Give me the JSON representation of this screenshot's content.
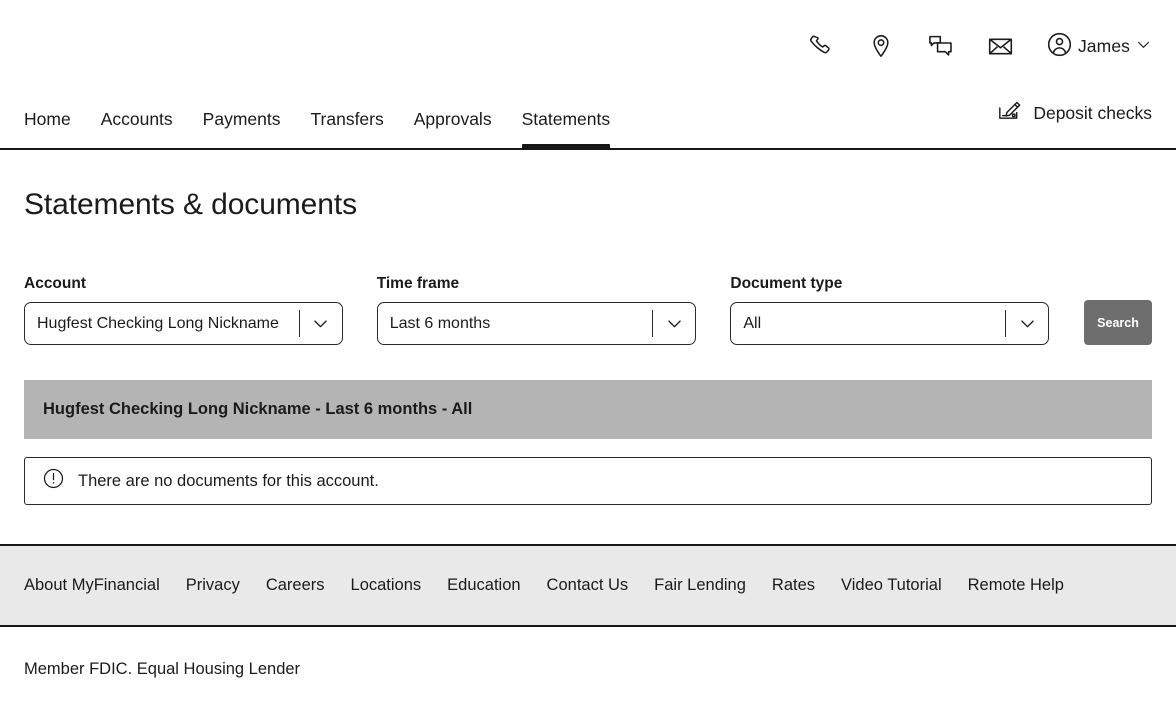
{
  "utility": {
    "icons": [
      {
        "name": "phone-icon",
        "label": "Call us"
      },
      {
        "name": "location-pin-icon",
        "label": "Find a location"
      },
      {
        "name": "chat-bubbles-icon",
        "label": "Chat"
      },
      {
        "name": "envelope-icon",
        "label": "Messages"
      }
    ],
    "profile": {
      "icon": "user-circle-icon",
      "name": "James",
      "chevron": "chevron-down-icon"
    }
  },
  "nav": {
    "items": [
      {
        "label": "Home",
        "active": false
      },
      {
        "label": "Accounts",
        "active": false
      },
      {
        "label": "Payments",
        "active": false
      },
      {
        "label": "Transfers",
        "active": false
      },
      {
        "label": "Approvals",
        "active": false
      },
      {
        "label": "Statements",
        "active": true
      }
    ],
    "deposit": {
      "label": "Deposit checks",
      "icon": "check-deposit-pen-icon"
    }
  },
  "page": {
    "title": "Statements & documents"
  },
  "filters": {
    "account": {
      "label": "Account",
      "value": "Hugfest Checking Long Nickname"
    },
    "time_frame": {
      "label": "Time frame",
      "value": "Last 6 months"
    },
    "document_type": {
      "label": "Document type",
      "value": "All"
    },
    "search_button": "Search"
  },
  "results": {
    "summary": "Hugfest Checking Long Nickname - Last 6 months - All",
    "alert": {
      "icon": "exclamation-circle-icon",
      "message": "There are no documents for this account."
    }
  },
  "footer": {
    "links": [
      "About MyFinancial",
      "Privacy",
      "Careers",
      "Locations",
      "Education",
      "Contact Us",
      "Fair Lending",
      "Rates",
      "Video Tutorial",
      "Remote Help"
    ],
    "legal": "Member FDIC.  Equal Housing Lender"
  },
  "colors": {
    "accent_black": "#171717",
    "text": "#1b1b1b",
    "results_bar": "#b4b4b4",
    "footer_bg": "#e9e9e9",
    "search_button": "#6e6e6e"
  }
}
